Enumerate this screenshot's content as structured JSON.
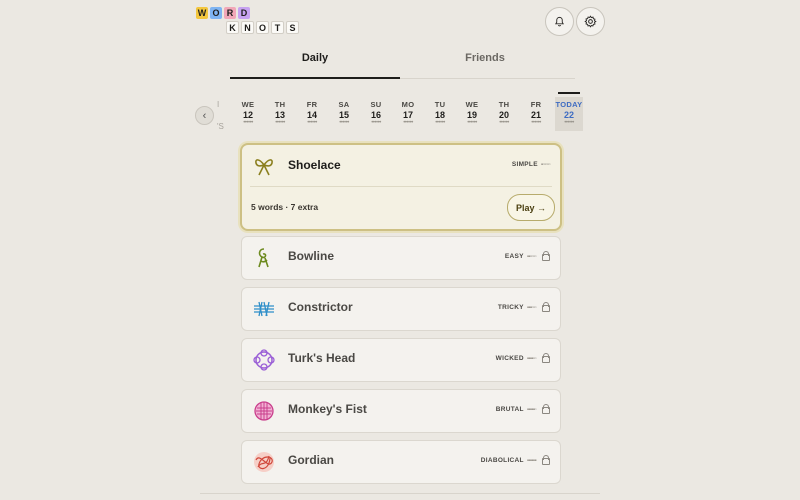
{
  "logo": {
    "row1": [
      "W",
      "O",
      "R",
      "D"
    ],
    "row2": [
      "K",
      "N",
      "O",
      "T",
      "S"
    ]
  },
  "header": {
    "notifications_icon": "bell-icon",
    "settings_icon": "gear-icon"
  },
  "tabs": [
    {
      "label": "Daily",
      "active": true
    },
    {
      "label": "Friends",
      "active": false
    }
  ],
  "date_strip": {
    "back_icon": "chevron-left-icon",
    "partial_left": {
      "dow": "I",
      "dots": "'S"
    },
    "dates": [
      {
        "dow": "WE",
        "day": "12"
      },
      {
        "dow": "TH",
        "day": "13"
      },
      {
        "dow": "FR",
        "day": "14"
      },
      {
        "dow": "SA",
        "day": "15"
      },
      {
        "dow": "SU",
        "day": "16"
      },
      {
        "dow": "MO",
        "day": "17"
      },
      {
        "dow": "TU",
        "day": "18"
      },
      {
        "dow": "WE",
        "day": "19"
      },
      {
        "dow": "TH",
        "day": "20"
      },
      {
        "dow": "FR",
        "day": "21"
      },
      {
        "dow": "TODAY",
        "day": "22",
        "today": true
      }
    ],
    "dots": "••••••"
  },
  "puzzles": {
    "active": {
      "name": "Shoelace",
      "difficulty": "SIMPLE",
      "bars": "▪▫▫▫▫▫",
      "meta": "5 words · 7 extra",
      "play_label": "Play →",
      "icon": "bow-knot-icon"
    },
    "locked": [
      {
        "name": "Bowline",
        "difficulty": "EASY",
        "bars": "▪▪▫▫▫▫",
        "icon": "bowline-knot-icon"
      },
      {
        "name": "Constrictor",
        "difficulty": "TRICKY",
        "bars": "▪▪▪▫▫▫",
        "icon": "constrictor-knot-icon"
      },
      {
        "name": "Turk's Head",
        "difficulty": "WICKED",
        "bars": "▪▪▪▪▫▫",
        "icon": "turks-head-knot-icon"
      },
      {
        "name": "Monkey's Fist",
        "difficulty": "BRUTAL",
        "bars": "▪▪▪▪▪▫",
        "icon": "monkeys-fist-knot-icon"
      },
      {
        "name": "Gordian",
        "difficulty": "DIABOLICAL",
        "bars": "▪▪▪▪▪▪",
        "icon": "gordian-knot-icon"
      }
    ]
  },
  "colors": {
    "accent": "#cdc084",
    "today": "#3e6cc2",
    "background": "#ebe8e2"
  }
}
